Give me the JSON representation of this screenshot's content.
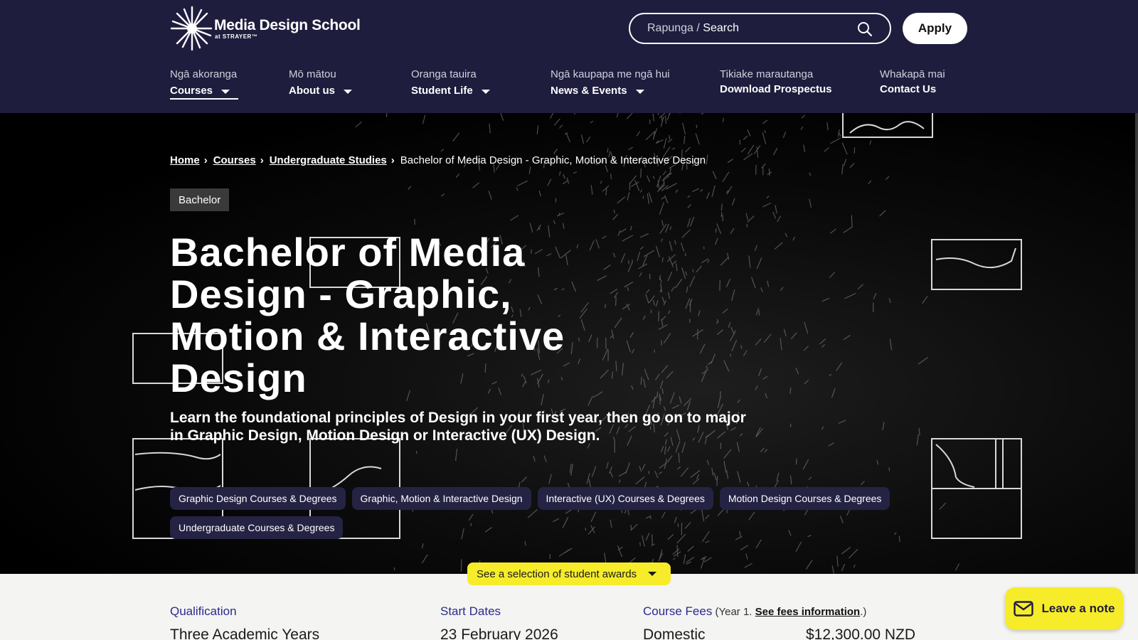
{
  "brand": {
    "name": "Media Design School",
    "sub": "at STRAYER™"
  },
  "search": {
    "label_maori": "Rapunga / ",
    "label_english": "Search"
  },
  "apply_label": "Apply",
  "nav": [
    {
      "sub": "Ngā akoranga",
      "main": "Courses"
    },
    {
      "sub": "Mō mātou",
      "main": "About us"
    },
    {
      "sub": "Oranga tauira",
      "main": "Student Life"
    },
    {
      "sub": "Ngā kaupapa me ngā hui",
      "main": "News & Events"
    },
    {
      "sub": "Tikiake marautanga",
      "main": "Download Prospectus"
    },
    {
      "sub": "Whakapā mai",
      "main": "Contact Us"
    }
  ],
  "breadcrumb": {
    "home": "Home",
    "courses": "Courses",
    "undergrad": "Undergraduate Studies",
    "current": "Bachelor of Media Design - Graphic, Motion & Interactive Design"
  },
  "badge": "Bachelor",
  "hero": {
    "title": "Bachelor of Media Design - Graphic, Motion & Interactive Design",
    "description": "Learn the foundational principles of Design in your first year, then go on to major in Graphic Design, Motion Design or Interactive (UX) Design."
  },
  "tags": [
    "Graphic Design Courses & Degrees",
    "Graphic, Motion & Interactive Design",
    "Interactive (UX) Courses & Degrees",
    "Motion Design Courses & Degrees",
    "Undergraduate Courses & Degrees"
  ],
  "awards_label": "See a selection of student awards",
  "info": {
    "qualification_label": "Qualification",
    "qualification_value": "Three Academic Years",
    "start_label": "Start Dates",
    "start_value": "23 February 2026",
    "fees_label": "Course Fees",
    "fees_note_before": " (Year 1. ",
    "fees_link": "See fees information",
    "fees_note_after": ".)",
    "fees_domestic_label": "Domestic",
    "fees_domestic_value": "$12,300.00 NZD"
  },
  "leave_note": "Leave a note",
  "colors": {
    "header_bg": "#1f1d3d",
    "accent_yellow": "#f6ec2a",
    "link_blue": "#2b2a8f"
  }
}
